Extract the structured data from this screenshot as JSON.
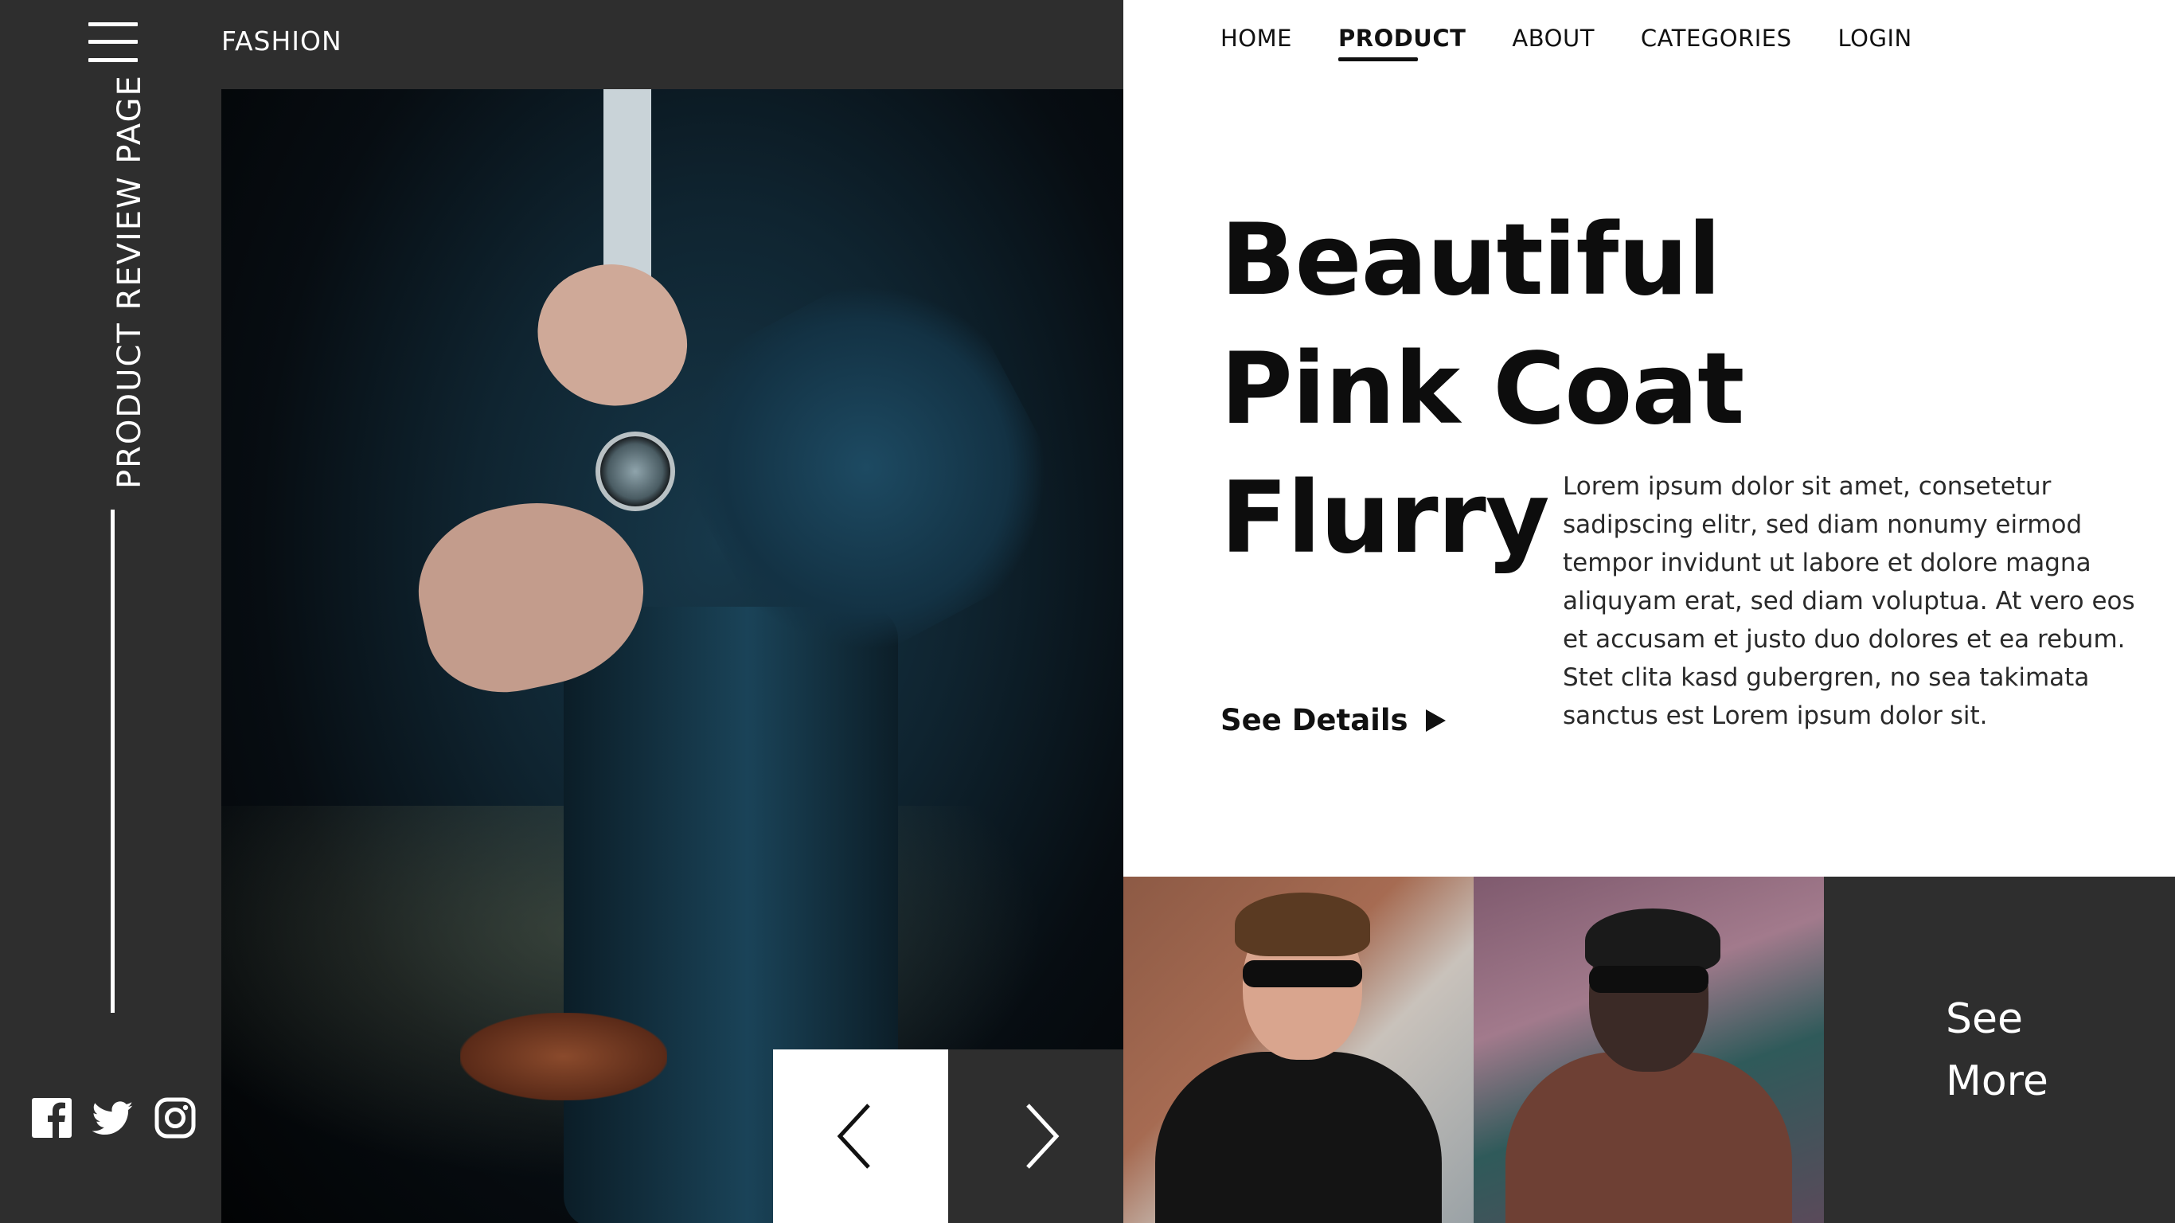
{
  "brand": "FASHION",
  "sidebar": {
    "vertical_label": "PRODUCT REVIEW PAGE",
    "social": [
      "facebook-icon",
      "twitter-icon",
      "instagram-icon"
    ]
  },
  "nav": {
    "items": [
      "HOME",
      "PRODUCT",
      "ABOUT",
      "CATEGORIES",
      "LOGIN"
    ],
    "active": "PRODUCT"
  },
  "hero": {
    "title_lines": [
      "Beautiful",
      "Pink Coat",
      "Flurry"
    ],
    "description": "Lorem ipsum dolor sit amet, consetetur sadipscing elitr, sed diam nonumy eirmod tempor invidunt ut labore et dolore magna aliquyam erat, sed diam voluptua. At vero eos et accusam et justo duo dolores et ea rebum. Stet clita kasd gubergren, no sea takimata sanctus est Lorem ipsum dolor sit.",
    "cta": "See Details"
  },
  "gallery": {
    "see_more_lines": [
      "See",
      "More"
    ]
  },
  "colors": {
    "dark_panel": "#2e2e2e",
    "text": "#111111",
    "white": "#ffffff"
  }
}
